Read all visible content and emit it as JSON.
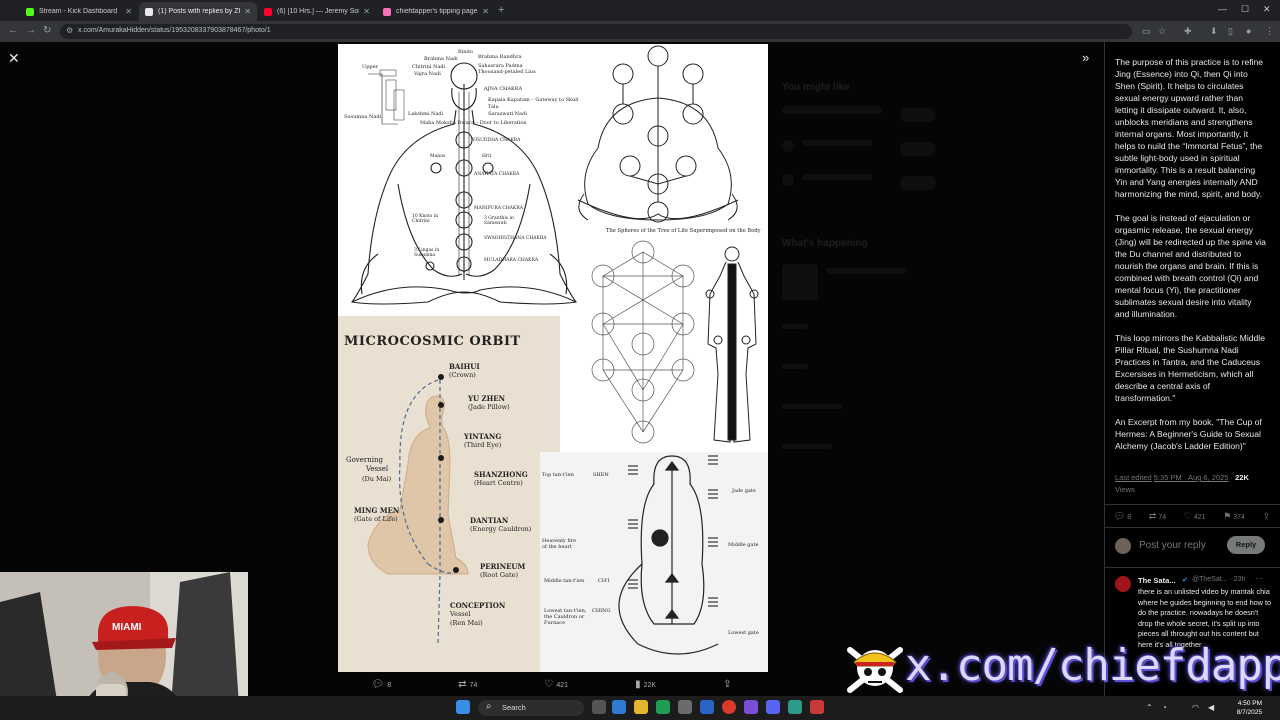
{
  "browser": {
    "tabs": [
      {
        "label": "Stream - Kick Dashboard",
        "color": "#53fc18"
      },
      {
        "label": "(1) Posts with replies by Zherk...",
        "color": "#e8eaed"
      },
      {
        "label": "(6) [10 Hrs.] — Jeremy Soule...",
        "color": "#ff0033"
      },
      {
        "label": "chiefdapper's tipping page",
        "color": "#f472b6"
      }
    ],
    "url": "x.com/AmurakaHidden/status/1953208337903878467/photo/1"
  },
  "diagram_labels": {
    "chakra": [
      "Bindu",
      "Brahma Randhra",
      "Brahma Nadi",
      "Sahasrara Padma",
      "Thousand-petaled Lius",
      "Upper",
      "Chitrini Nadi",
      "Vajra Nadi",
      "Susumna Nadi",
      "Lakshmi Nadi",
      "AJNA CHAKRA",
      "Kapala Kapatam – Gateway to Skull",
      "Talu",
      "Saraswati Nadi",
      "Maha Moksha Dwara – Door to Liberation",
      "VISUDDHA CHAKRA",
      "Manas",
      "Hrit",
      "ANAHATA CHAKRA",
      "MANIPURA CHAKRA",
      "10 Knots in Chitrini",
      "3 Granthis in Saraswati",
      "SWADHISTHANA CHAKRA",
      "3 Lingas in Susumna",
      "MULADHARA CHAKRA"
    ],
    "sephiroth_caption": "The Spheres of the Tree of Life Superimposed on the Body",
    "orbit_title": "MICROCOSMIC ORBIT",
    "orbit": [
      {
        "name": "BAIHUI",
        "sub": "(Crown)"
      },
      {
        "name": "YU ZHEN",
        "sub": "(Jade Pillow)"
      },
      {
        "name": "YINTANG",
        "sub": "(Third Eye)"
      },
      {
        "name": "SHANZHONG",
        "sub": "(Heart Centre)"
      },
      {
        "name": "DANTIAN",
        "sub": "(Energy Cauldron)"
      },
      {
        "name": "PERINEUM",
        "sub": "(Root Gate)"
      },
      {
        "name": "CONCEPTION",
        "sub": "Vessel"
      },
      {
        "name": "(Ren Mai)",
        "sub": ""
      },
      {
        "name": "Governing",
        "sub": "Vessel"
      },
      {
        "name": "(Du Mai)",
        "sub": ""
      },
      {
        "name": "MING MEN",
        "sub": "(Gate of Life)"
      }
    ],
    "chinese_panel": [
      "Top tan-t'ien",
      "SHEN",
      "Jade gate",
      "Heavenly fire of the heart",
      "Middle gate",
      "Middle tan-t'ien",
      "CH'I",
      "Lowest tan-t'ien, the Cauldron or Furnace",
      "CHING",
      "Lowest gate"
    ]
  },
  "photo_actions": {
    "replies": "8",
    "reposts": "74",
    "likes": "421",
    "views": "22K"
  },
  "post": {
    "paragraphs": [
      "The purpose of this practice is to refine Jing (Essence) into Qi, then Qi into Shen (Spirit). It helps to circulates sexual energy upward rather than letting it dissipate outward. It, also, unblocks meridians and strengthens internal organs. Most importantly, it helps to nuild the “Immortal Fetus”, the subtle light-body used in spiritual immortality. This is a result balancing Yin and Yang energies internally AND harmonizing the mind, spirit, and body.",
      "The goal is instead of ejaculation or orgasmic release, the sexual energy (Jing) will be redirected up the spine via the Du channel and distributed to nourish the organs and brain. If this is combined with breath control (Qi) and mental focus (Yi), the practitioner sublimates sexual desire into vitality and illumination.",
      "This loop mirrors the Kabbalistic Middle Pillar Ritual, the Sushumna Nadi Practices in Tantra, and the Caduceus Excersises in Hermeticism, which all describe a central axis of transformation.\"",
      "An Excerpt from my book, \"The Cup of Hermes: A Beginner's Guide to Sexual Alchemy (Jacob's Ladder Edition)\""
    ],
    "last_edited": "Last edited",
    "timestamp": "5:35 PM · Aug 6, 2025",
    "views_count": "22K",
    "views_label": "Views",
    "stats": {
      "replies": "8",
      "reposts": "74",
      "likes": "421",
      "bookmarks": "374"
    },
    "reply_placeholder": "Post your reply",
    "reply_button": "Reply"
  },
  "reply": {
    "name": "The Sata...",
    "handle": "@TheSat... · 23h",
    "text": "there is an unlisted video by mantak chia where he guides beginning to end how to do the practice. nowadays he doesn't drop the whole secret, it's split up into pieces all throught out his content but here it's all together"
  },
  "faded_sidebar": {
    "heading1": "You might like",
    "heading2": "What's happening"
  },
  "watermark": "x.com/chiefdapper",
  "taskbar": {
    "search": "Search",
    "time": "4:50 PM",
    "date": "8/7/2025"
  }
}
